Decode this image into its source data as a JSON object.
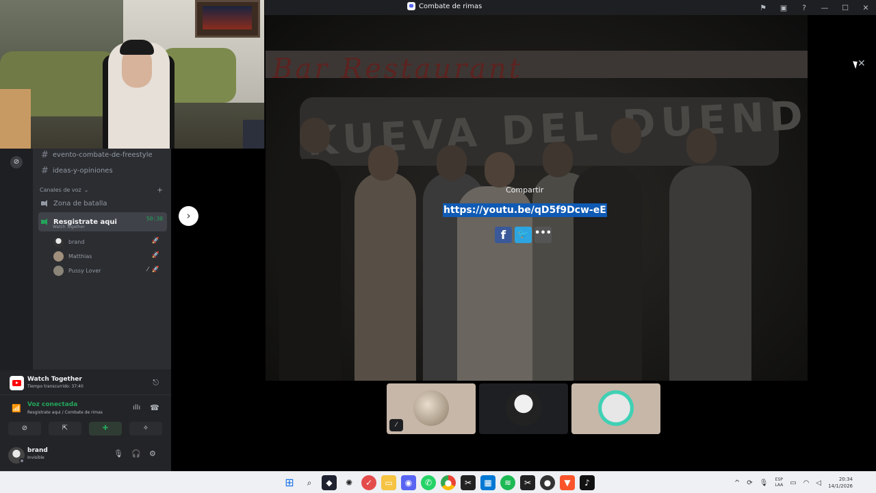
{
  "window": {
    "title": "Combate de rimas"
  },
  "sidebar": {
    "text_channels": [
      {
        "name": "evento-combate-de-freestyle"
      },
      {
        "name": "ideas-y-opiniones"
      }
    ],
    "voice_category": "Canales de voz",
    "voice_channels": [
      {
        "name": "Zona de batalla"
      },
      {
        "name": "Resgistrate aqui",
        "timer": "50:30",
        "activity": "Watch Together"
      }
    ],
    "members": [
      {
        "name": "brand"
      },
      {
        "name": "Matthias"
      },
      {
        "name": "Pussy Lover"
      }
    ]
  },
  "activity_panel": {
    "name": "Watch Together",
    "elapsed": "Tiempo transcurrido: 37:40"
  },
  "voice_panel": {
    "status": "Voz conectada",
    "location": "Resgistrate aqui / Combate de rimas"
  },
  "user_panel": {
    "name": "brand",
    "status": "Invisible"
  },
  "share": {
    "title": "Compartir",
    "url": "https://youtu.be/qD5f9Dcw-eE",
    "buttons": [
      {
        "label": "f",
        "icon": "facebook-icon"
      },
      {
        "label": "🐦",
        "icon": "twitter-icon"
      },
      {
        "label": "•••",
        "icon": "more-icon"
      }
    ]
  },
  "video": {
    "banner_text": "Bar Restaurant",
    "graffiti_text": "KUEVA DEL DUENDE"
  },
  "taskbar": {
    "language_line1": "ESP",
    "language_line2": "LAA",
    "time": "20:34",
    "date": "14/1/2026"
  }
}
